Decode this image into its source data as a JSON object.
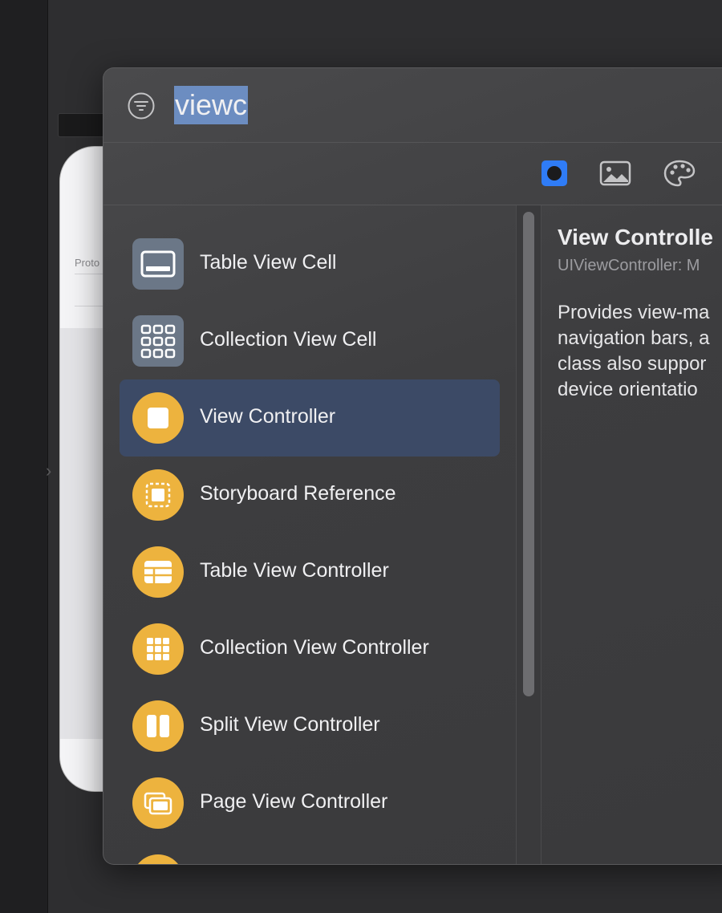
{
  "canvas": {
    "scene_label": "Proto"
  },
  "search": {
    "value": "viewc"
  },
  "tabs": [
    {
      "name": "objects",
      "active": true
    },
    {
      "name": "media",
      "active": false
    },
    {
      "name": "colors",
      "active": false
    }
  ],
  "items": [
    {
      "label": "Table View Cell",
      "icon": "table-view-cell-icon"
    },
    {
      "label": "Collection View Cell",
      "icon": "collection-view-cell-icon"
    },
    {
      "label": "View Controller",
      "icon": "view-controller-icon",
      "selected": true
    },
    {
      "label": "Storyboard Reference",
      "icon": "storyboard-reference-icon"
    },
    {
      "label": "Table View Controller",
      "icon": "table-view-controller-icon"
    },
    {
      "label": "Collection View Controller",
      "icon": "collection-view-controller-icon"
    },
    {
      "label": "Split View Controller",
      "icon": "split-view-controller-icon"
    },
    {
      "label": "Page View Controller",
      "icon": "page-view-controller-icon"
    }
  ],
  "detail": {
    "title": "View Controlle",
    "subtitle": "UIViewController: M",
    "description_lines": [
      "Provides view-ma",
      "navigation bars, a",
      "class also suppor",
      "device orientatio"
    ]
  },
  "colors": {
    "accent": "#2f7cf6",
    "icon_orange": "#edb33e",
    "icon_gray": "#6b7787",
    "selection": "#3c4a66"
  }
}
